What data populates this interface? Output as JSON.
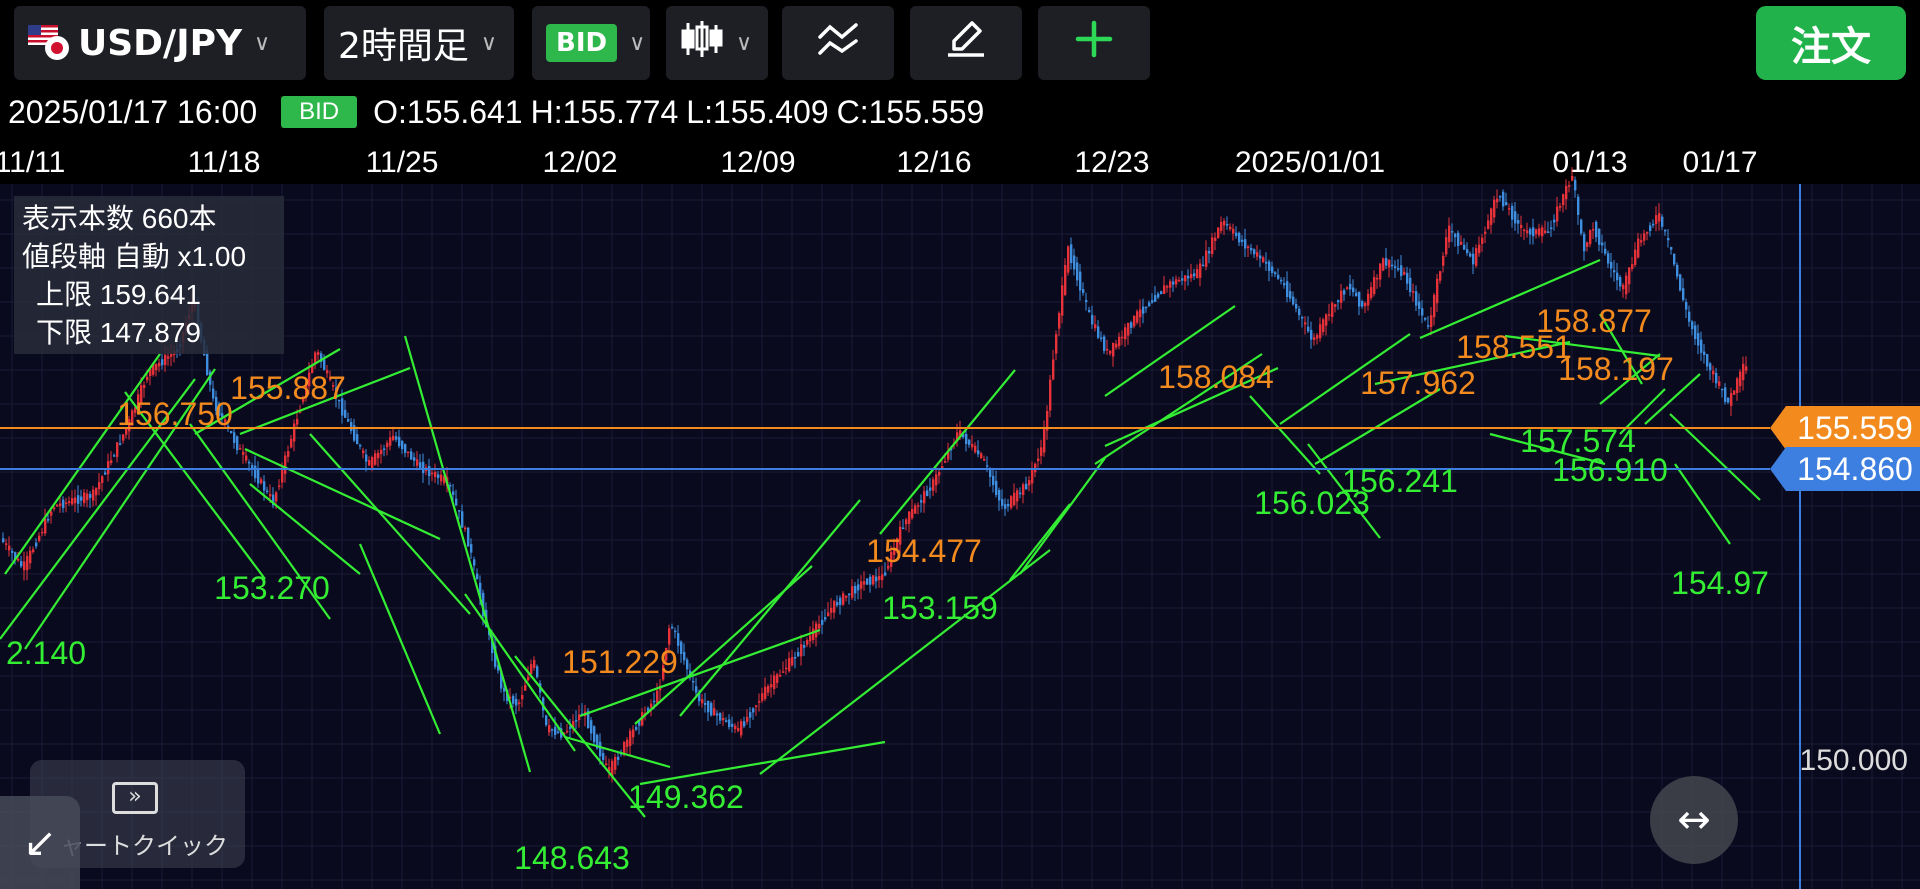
{
  "toolbar": {
    "pair": "USD/JPY",
    "timeframe": "2時間足",
    "price_type": "BID",
    "order_label": "注文"
  },
  "ohlc": {
    "datetime": "2025/01/17 16:00",
    "badge": "BID",
    "open": "O:155.641",
    "high": "H:155.774",
    "low": "L:155.409",
    "close": "C:155.559"
  },
  "info": {
    "bars": "表示本数 660本",
    "axis": "値段軸 自動 x1.00",
    "upper": "上限 159.641",
    "lower": "下限 147.879"
  },
  "quick": {
    "label": "ャートクイック"
  },
  "colors": {
    "up": "#e8323a",
    "down": "#3f8fe0",
    "trend": "#33ee33",
    "orange": "#f28a1e",
    "blue_line": "#3d7fe0",
    "bg": "#0a0a1e"
  },
  "chart_data": {
    "type": "candlestick",
    "ylim": [
      147.879,
      159.641
    ],
    "x_ticks": [
      "11/11",
      "11/18",
      "11/25",
      "12/02",
      "12/09",
      "12/16",
      "12/23",
      "2025/01/01",
      "01/13",
      "01/17"
    ],
    "y_ticks": [
      "150.000"
    ],
    "price_labels": [
      {
        "text": "155.559",
        "value": 155.559,
        "color": "#f28a1e"
      },
      {
        "text": "154.860",
        "value": 154.86,
        "color": "#3d7fe0"
      }
    ],
    "annotations": [
      {
        "text": "2.140",
        "color": "green"
      },
      {
        "text": "155.887",
        "color": "orange"
      },
      {
        "text": "153.270",
        "color": "green"
      },
      {
        "text": "151.229",
        "color": "orange"
      },
      {
        "text": "148.643",
        "color": "green"
      },
      {
        "text": "149.362",
        "color": "green"
      },
      {
        "text": "154.477",
        "color": "orange"
      },
      {
        "text": "153.159",
        "color": "green"
      },
      {
        "text": "158.084",
        "color": "orange"
      },
      {
        "text": "156.023",
        "color": "green"
      },
      {
        "text": "156.241",
        "color": "green"
      },
      {
        "text": "157.962",
        "color": "orange"
      },
      {
        "text": "158.551",
        "color": "orange"
      },
      {
        "text": "158.877",
        "color": "orange"
      },
      {
        "text": "158.197",
        "color": "orange"
      },
      {
        "text": "157.574",
        "color": "green"
      },
      {
        "text": "156.910",
        "color": "green"
      },
      {
        "text": "154.97",
        "color": "green"
      },
      {
        "text": "156.750",
        "color": "orange"
      }
    ],
    "path": [
      [
        0,
        152.7
      ],
      [
        25,
        152.14
      ],
      [
        55,
        153.2
      ],
      [
        95,
        153.4
      ],
      [
        130,
        154.6
      ],
      [
        150,
        155.5
      ],
      [
        180,
        155.9
      ],
      [
        195,
        156.75
      ],
      [
        215,
        155.0
      ],
      [
        240,
        154.2
      ],
      [
        275,
        153.27
      ],
      [
        300,
        154.8
      ],
      [
        318,
        155.887
      ],
      [
        345,
        154.8
      ],
      [
        370,
        153.9
      ],
      [
        395,
        154.4
      ],
      [
        420,
        153.9
      ],
      [
        450,
        153.6
      ],
      [
        470,
        152.6
      ],
      [
        490,
        151.0
      ],
      [
        505,
        150.0
      ],
      [
        520,
        149.8
      ],
      [
        535,
        150.6
      ],
      [
        548,
        149.4
      ],
      [
        565,
        149.3
      ],
      [
        585,
        149.7
      ],
      [
        610,
        148.643
      ],
      [
        640,
        149.5
      ],
      [
        660,
        150.0
      ],
      [
        672,
        151.229
      ],
      [
        700,
        149.9
      ],
      [
        720,
        149.6
      ],
      [
        740,
        149.362
      ],
      [
        765,
        150.0
      ],
      [
        800,
        150.7
      ],
      [
        835,
        151.5
      ],
      [
        865,
        151.9
      ],
      [
        885,
        152.0
      ],
      [
        905,
        152.9
      ],
      [
        935,
        153.6
      ],
      [
        960,
        154.477
      ],
      [
        985,
        154.0
      ],
      [
        1005,
        153.159
      ],
      [
        1030,
        153.6
      ],
      [
        1045,
        154.3
      ],
      [
        1058,
        156.2
      ],
      [
        1070,
        157.6
      ],
      [
        1078,
        157.2
      ],
      [
        1092,
        156.4
      ],
      [
        1110,
        155.8
      ],
      [
        1140,
        156.5
      ],
      [
        1170,
        157.0
      ],
      [
        1200,
        157.2
      ],
      [
        1224,
        158.084
      ],
      [
        1245,
        157.7
      ],
      [
        1265,
        157.4
      ],
      [
        1285,
        157.0
      ],
      [
        1315,
        156.023
      ],
      [
        1330,
        156.5
      ],
      [
        1350,
        157.0
      ],
      [
        1365,
        156.6
      ],
      [
        1385,
        157.4
      ],
      [
        1405,
        157.2
      ],
      [
        1430,
        156.241
      ],
      [
        1450,
        157.962
      ],
      [
        1475,
        157.4
      ],
      [
        1500,
        158.551
      ],
      [
        1525,
        157.9
      ],
      [
        1550,
        157.9
      ],
      [
        1574,
        158.877
      ],
      [
        1585,
        157.574
      ],
      [
        1595,
        158.0
      ],
      [
        1612,
        157.3
      ],
      [
        1625,
        156.91
      ],
      [
        1640,
        157.7
      ],
      [
        1660,
        158.197
      ],
      [
        1672,
        157.6
      ],
      [
        1690,
        156.4
      ],
      [
        1710,
        155.6
      ],
      [
        1730,
        154.97
      ],
      [
        1745,
        155.559
      ]
    ]
  }
}
